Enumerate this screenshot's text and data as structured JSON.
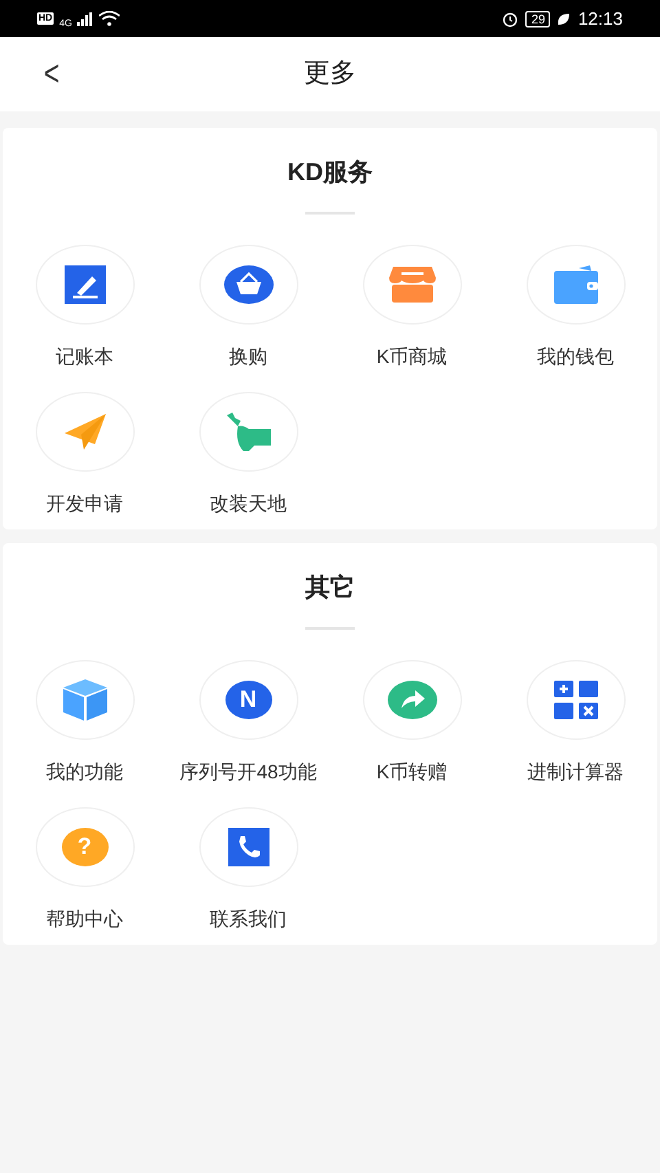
{
  "status_bar": {
    "hd": "HD",
    "network": "4G",
    "battery": "29",
    "time": "12:13"
  },
  "header": {
    "back": "<",
    "title": "更多"
  },
  "sections": [
    {
      "title": "KD服务",
      "items": [
        {
          "label": "记账本"
        },
        {
          "label": "换购"
        },
        {
          "label": "K币商城"
        },
        {
          "label": "我的钱包"
        },
        {
          "label": "开发申请"
        },
        {
          "label": "改装天地"
        }
      ]
    },
    {
      "title": "其它",
      "items": [
        {
          "label": "我的功能"
        },
        {
          "label": "序列号开48功能",
          "glyph": "N"
        },
        {
          "label": "K币转赠"
        },
        {
          "label": "进制计算器"
        },
        {
          "label": "帮助中心",
          "glyph": "?"
        },
        {
          "label": "联系我们"
        }
      ]
    }
  ]
}
